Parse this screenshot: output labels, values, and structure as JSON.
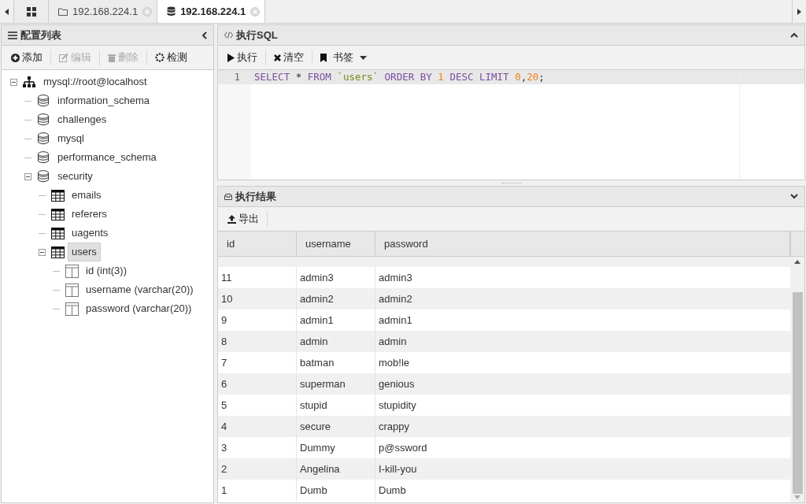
{
  "tabs": [
    {
      "kind": "home",
      "selected": false
    },
    {
      "kind": "folder",
      "label": "192.168.224.1",
      "selected": false
    },
    {
      "kind": "database",
      "label": "192.168.224.1",
      "selected": true
    }
  ],
  "sidebar": {
    "title": "配置列表",
    "toolbar": [
      {
        "kind": "add",
        "label": "添加",
        "disabled": false
      },
      {
        "kind": "edit",
        "label": "编辑",
        "disabled": true
      },
      {
        "kind": "delete",
        "label": "删除",
        "disabled": true
      },
      {
        "kind": "check",
        "label": "检测",
        "disabled": false
      }
    ],
    "tree": [
      {
        "kind": "server",
        "label": "mysql://root@localhost",
        "expanded": true,
        "selected": false,
        "children": [
          {
            "kind": "database",
            "label": "information_schema",
            "selected": false
          },
          {
            "kind": "database",
            "label": "challenges",
            "selected": false
          },
          {
            "kind": "database",
            "label": "mysql",
            "selected": false
          },
          {
            "kind": "database",
            "label": "performance_schema",
            "selected": false
          },
          {
            "kind": "database",
            "label": "security",
            "expanded": true,
            "selected": false,
            "children": [
              {
                "kind": "table",
                "label": "emails",
                "selected": false
              },
              {
                "kind": "table",
                "label": "referers",
                "selected": false
              },
              {
                "kind": "table",
                "label": "uagents",
                "selected": false
              },
              {
                "kind": "table",
                "label": "users",
                "expanded": true,
                "selected": true,
                "children": [
                  {
                    "kind": "column",
                    "label": "id (int(3))",
                    "selected": false
                  },
                  {
                    "kind": "column",
                    "label": "username (varchar(20))",
                    "selected": false
                  },
                  {
                    "kind": "column",
                    "label": "password (varchar(20))",
                    "selected": false
                  }
                ]
              }
            ]
          }
        ]
      }
    ]
  },
  "sql_panel": {
    "title": "执行SQL",
    "toolbar": [
      {
        "kind": "run",
        "label": "执行"
      },
      {
        "kind": "clear",
        "label": "清空"
      },
      {
        "kind": "bookmark",
        "label": "书签"
      }
    ],
    "editor": {
      "lines": [
        {
          "number": "1",
          "tokens": [
            {
              "kind": "keyword",
              "text": "SELECT"
            },
            {
              "kind": "plain",
              "text": " * "
            },
            {
              "kind": "keyword",
              "text": "FROM "
            },
            {
              "kind": "string",
              "text": "`users`"
            },
            {
              "kind": "keyword",
              "text": " ORDER BY "
            },
            {
              "kind": "number",
              "text": "1"
            },
            {
              "kind": "keyword",
              "text": " DESC LIMIT "
            },
            {
              "kind": "number",
              "text": "0"
            },
            {
              "kind": "plain",
              "text": ","
            },
            {
              "kind": "number",
              "text": "20"
            },
            {
              "kind": "plain",
              "text": ";"
            }
          ]
        }
      ]
    }
  },
  "results_panel": {
    "title": "执行结果",
    "toolbar": [
      {
        "kind": "export",
        "label": "导出"
      }
    ],
    "table": {
      "columns": [
        "id",
        "username",
        "password"
      ],
      "rows": [
        [
          "11",
          "admin3",
          "admin3"
        ],
        [
          "10",
          "admin2",
          "admin2"
        ],
        [
          "9",
          "admin1",
          "admin1"
        ],
        [
          "8",
          "admin",
          "admin"
        ],
        [
          "7",
          "batman",
          "mob!le"
        ],
        [
          "6",
          "superman",
          "genious"
        ],
        [
          "5",
          "stupid",
          "stupidity"
        ],
        [
          "4",
          "secure",
          "crappy"
        ],
        [
          "3",
          "Dummy",
          "p@ssword"
        ],
        [
          "2",
          "Angelina",
          "I-kill-you"
        ],
        [
          "1",
          "Dumb",
          "Dumb"
        ]
      ]
    }
  }
}
